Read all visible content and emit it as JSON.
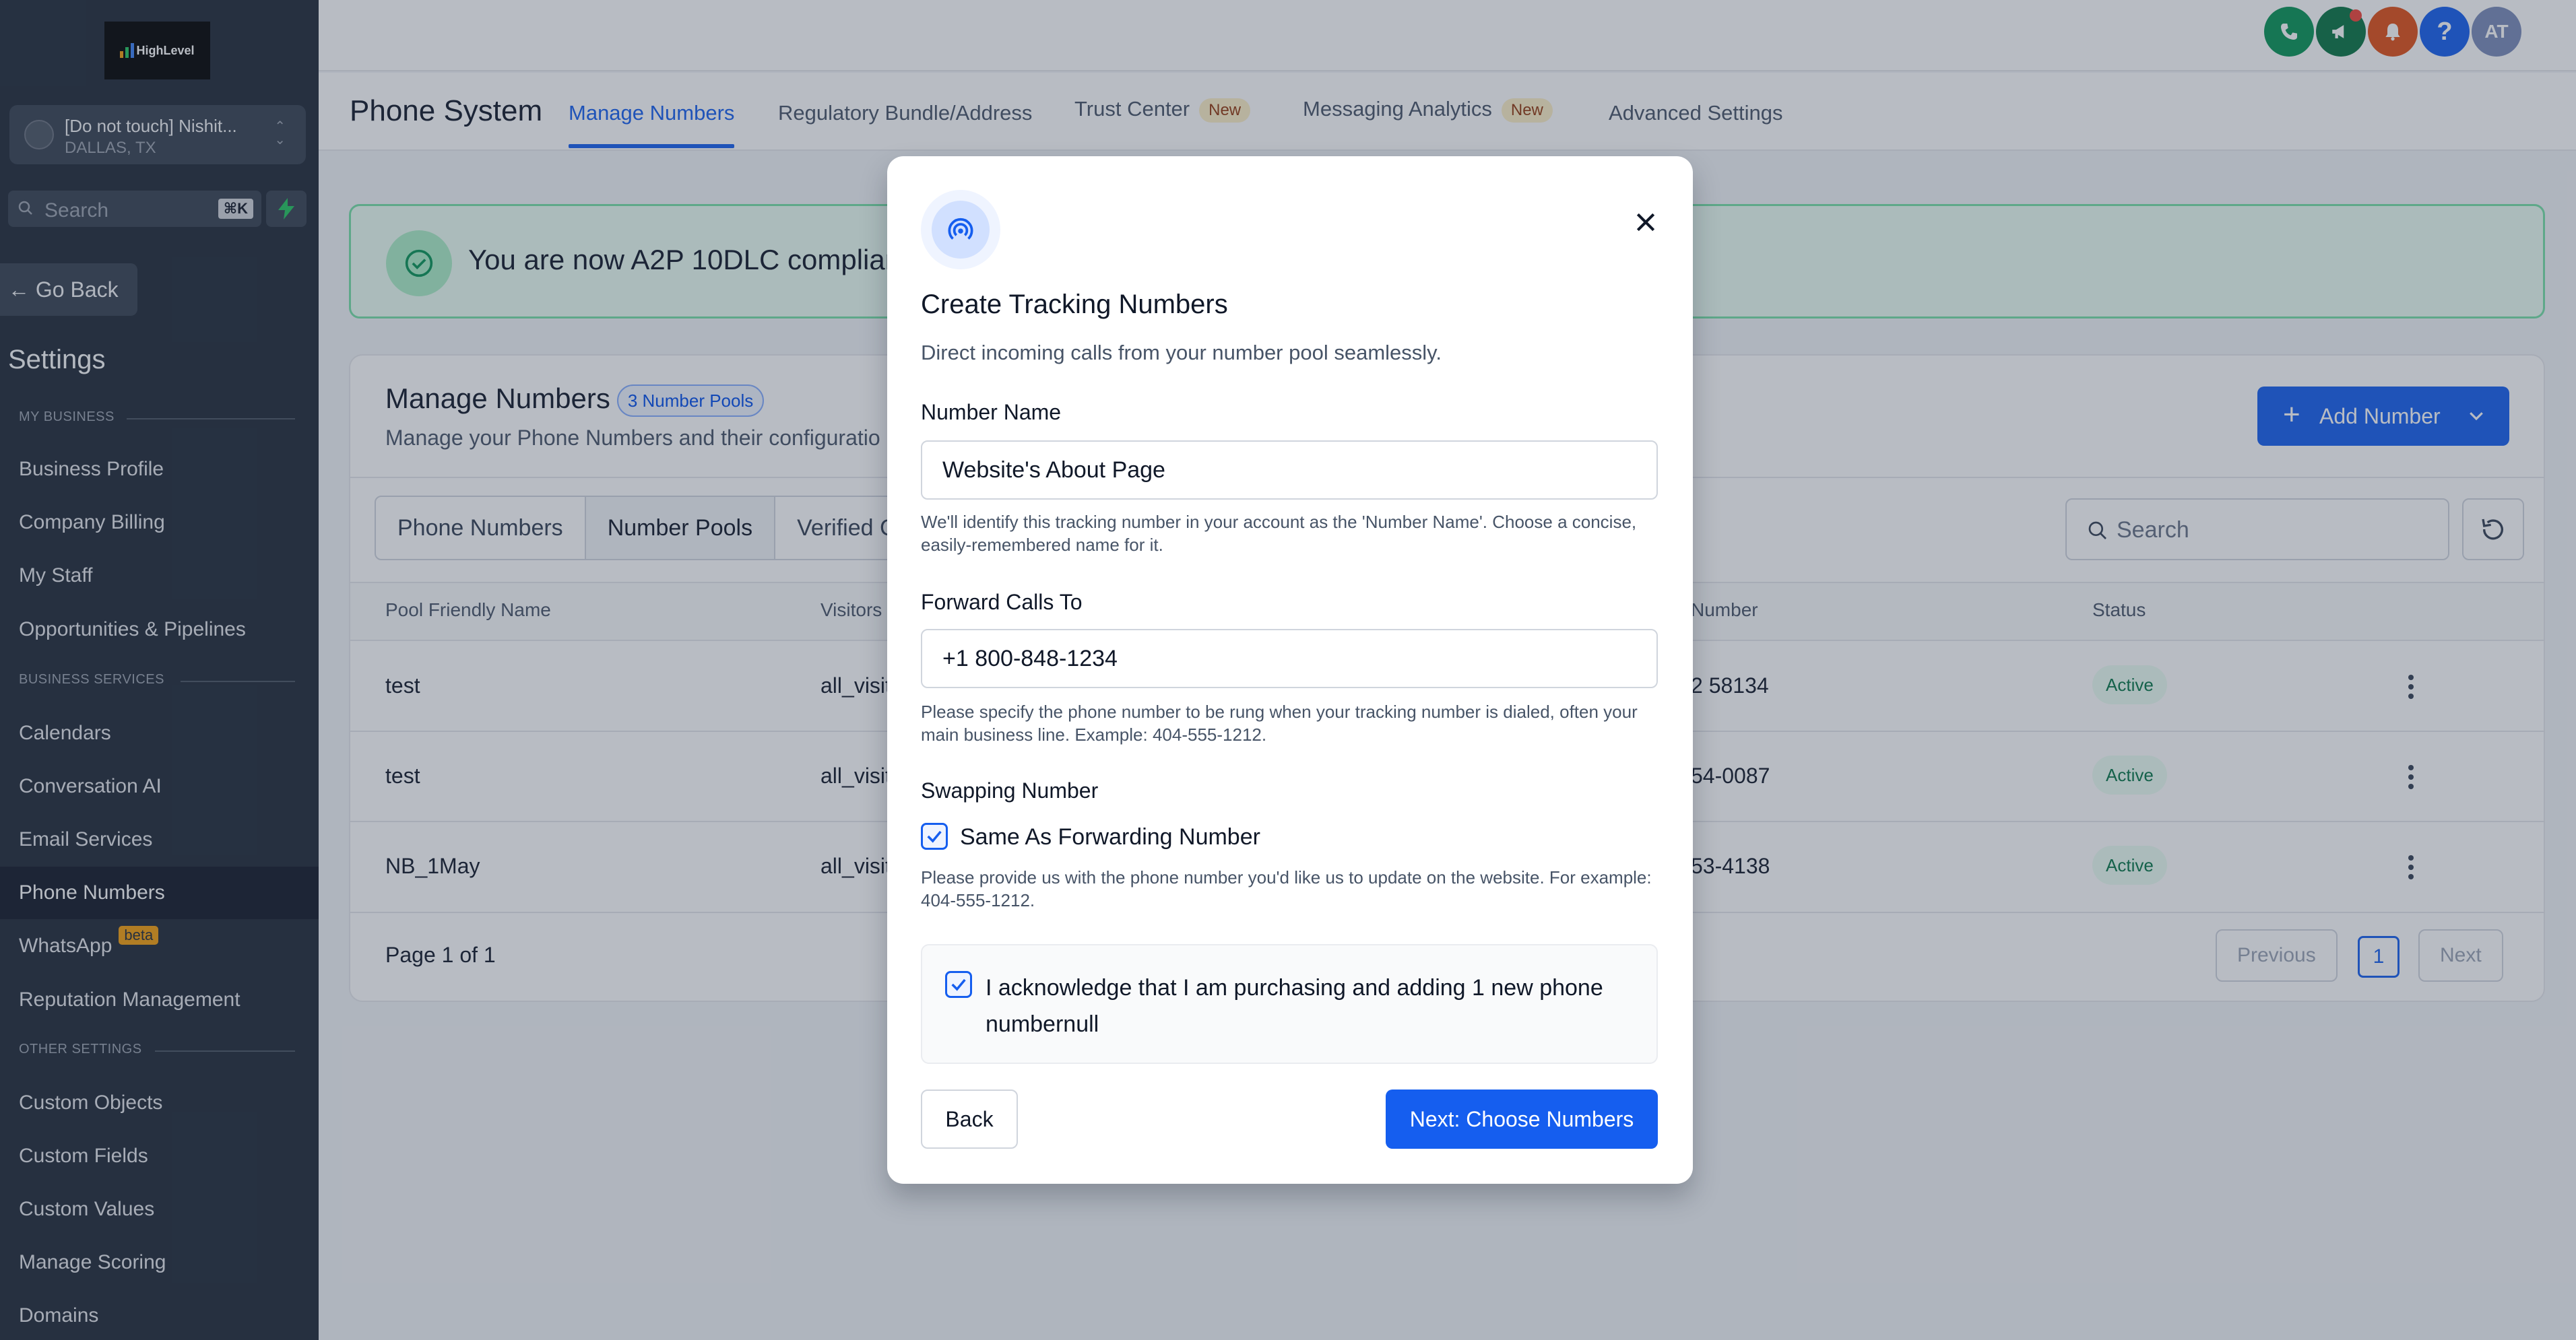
{
  "app": {
    "logo_text": "HighLevel"
  },
  "colors": {
    "primary": "#155eef",
    "sidebar_bg": "#1f2937",
    "success": "#067647",
    "warning_badge": "#fef0c7"
  },
  "sidebar": {
    "account_name": "[Do not touch] Nishit...",
    "account_location": "DALLAS, TX",
    "search_placeholder": "Search",
    "search_shortcut": "⌘K",
    "go_back": "Go Back",
    "settings_title": "Settings",
    "sections": [
      {
        "label": "MY BUSINESS",
        "items": [
          "Business Profile",
          "Company Billing",
          "My Staff",
          "Opportunities & Pipelines"
        ]
      },
      {
        "label": "BUSINESS SERVICES",
        "items": [
          "Calendars",
          "Conversation AI",
          "Email Services",
          "Phone Numbers",
          "WhatsApp",
          "Reputation Management"
        ]
      },
      {
        "label": "OTHER SETTINGS",
        "items": [
          "Custom Objects",
          "Custom Fields",
          "Custom Values",
          "Manage Scoring",
          "Domains"
        ]
      }
    ],
    "active_item": "Phone Numbers",
    "whatsapp_badge": "beta"
  },
  "topbar": {
    "avatar_initials": "AT",
    "icons": [
      "phone-icon",
      "megaphone-icon",
      "bell-icon",
      "help-icon"
    ]
  },
  "header": {
    "title": "Phone System",
    "tabs": [
      {
        "label": "Manage Numbers",
        "active": true
      },
      {
        "label": "Regulatory Bundle/Address"
      },
      {
        "label": "Trust Center",
        "badge": "New"
      },
      {
        "label": "Messaging Analytics",
        "badge": "New"
      },
      {
        "label": "Advanced Settings"
      }
    ]
  },
  "banner": {
    "text": "You are now A2P 10DLC complian"
  },
  "manage": {
    "title": "Manage Numbers",
    "pool_badge": "3 Number Pools",
    "subtitle": "Manage your Phone Numbers and their configuratio",
    "add_button": "Add Number",
    "segments": [
      "Phone Numbers",
      "Number Pools",
      "Verified C"
    ],
    "search_placeholder": "Search",
    "columns": [
      "Pool Friendly Name",
      "Visitors",
      "Number",
      "Status"
    ],
    "rows": [
      {
        "name": "test",
        "visitors": "all_visit",
        "number": "2 58134",
        "status": "Active"
      },
      {
        "name": "test",
        "visitors": "all_visit",
        "number": "54-0087",
        "status": "Active"
      },
      {
        "name": "NB_1May",
        "visitors": "all_visit",
        "number": "53-4138",
        "status": "Active"
      }
    ],
    "page_info": "Page 1 of 1",
    "prev": "Previous",
    "page_num": "1",
    "next": "Next"
  },
  "modal": {
    "title": "Create Tracking Numbers",
    "description": "Direct incoming calls from your number pool seamlessly.",
    "number_name_label": "Number Name",
    "number_name_value": "Website's About Page",
    "number_name_help": "We'll identify this tracking number in your account as the 'Number Name'. Choose a concise, easily-remembered name for it.",
    "forward_label": "Forward Calls To",
    "forward_value": "+1 800-848-1234",
    "forward_help": "Please specify the phone number to be rung when your tracking number is dialed, often your main business line. Example: 404-555-1212.",
    "swap_label": "Swapping Number",
    "swap_checkbox": "Same As Forwarding Number",
    "swap_help": "Please provide us with the phone number you'd like us to update on the website. For example: 404-555-1212.",
    "ack_text": "I acknowledge that I am purchasing and adding 1 new phone numbernull",
    "back_button": "Back",
    "next_button": "Next: Choose Numbers"
  }
}
